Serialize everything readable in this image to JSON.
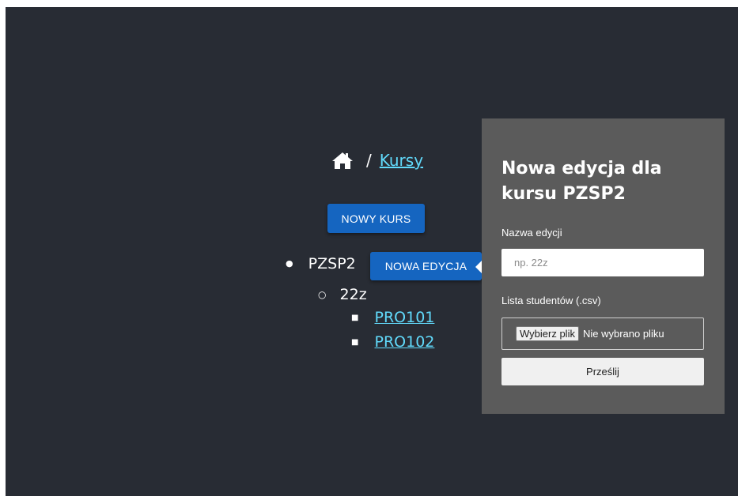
{
  "breadcrumb": {
    "home_icon": "home-icon",
    "separator": "/",
    "link": "Kursy"
  },
  "buttons": {
    "new_course": "NOWY KURS",
    "new_edition": "NOWA EDYCJA"
  },
  "tree": {
    "course": "PZSP2",
    "edition": "22z",
    "items": [
      "PRO101",
      "PRO102"
    ]
  },
  "popover": {
    "title": "Nowa edycja dla kursu PZSP2",
    "name_label": "Nazwa edycji",
    "name_placeholder": "np. 22z",
    "list_label": "Lista studentów (.csv)",
    "file_button": "Wybierz plik",
    "file_status": "Nie wybrano pliku",
    "submit": "Prześlij"
  },
  "colors": {
    "background": "#282c34",
    "link": "#61dafb",
    "button": "#1565c0",
    "popover": "#5b5b5b"
  }
}
